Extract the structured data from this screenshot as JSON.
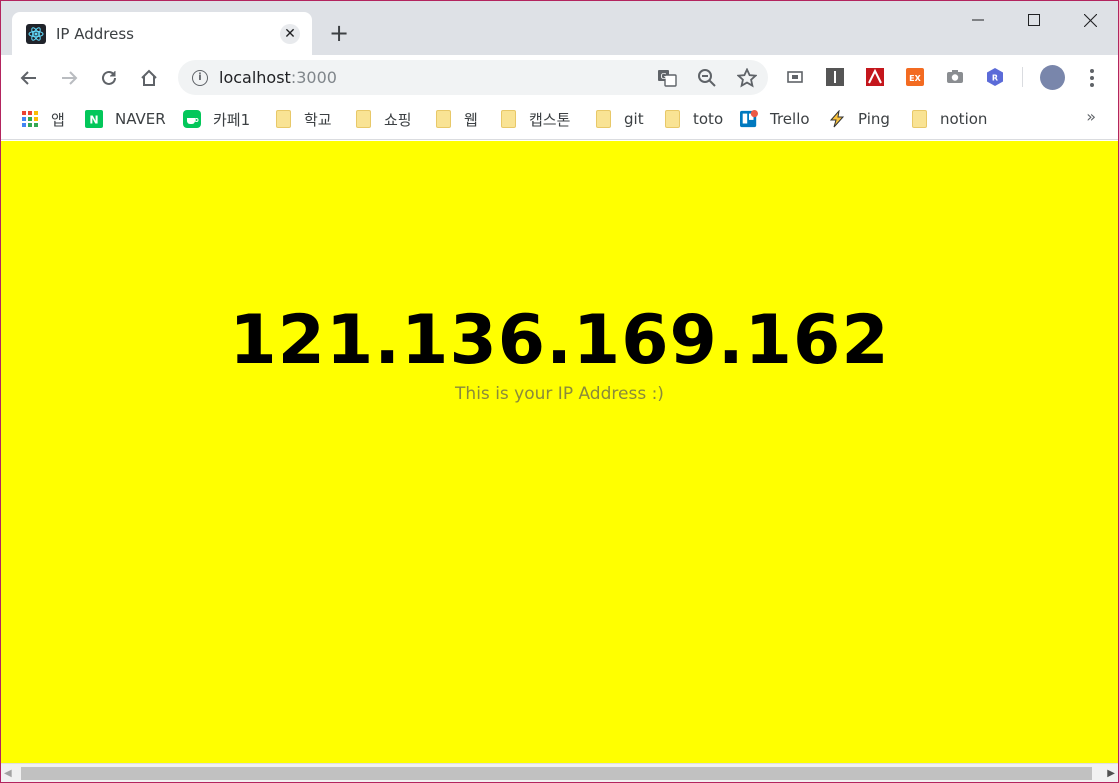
{
  "tab": {
    "title": "IP Address",
    "close_glyph": "✕",
    "new_tab_glyph": "+"
  },
  "address_bar": {
    "host": "localhost",
    "port": ":3000"
  },
  "bookmarks": [
    {
      "label": "앱",
      "icon": "apps-grid-icon"
    },
    {
      "label": "NAVER",
      "icon": "naver-icon"
    },
    {
      "label": "카페1",
      "icon": "cafe-icon"
    },
    {
      "label": "학교",
      "icon": "folder-icon"
    },
    {
      "label": "쇼핑",
      "icon": "folder-icon"
    },
    {
      "label": "웹",
      "icon": "folder-icon"
    },
    {
      "label": "캡스톤",
      "icon": "folder-icon"
    },
    {
      "label": "git",
      "icon": "folder-icon"
    },
    {
      "label": "toto",
      "icon": "folder-icon"
    },
    {
      "label": "Trello",
      "icon": "trello-icon"
    },
    {
      "label": "Ping",
      "icon": "bolt-icon"
    },
    {
      "label": "notion",
      "icon": "folder-icon"
    }
  ],
  "bookmarks_more": "»",
  "page": {
    "ip": "121.136.169.162",
    "caption": "This is your IP Address :)",
    "background": "#ffff00"
  },
  "extensions": {
    "ex_label": "EX",
    "r_label": "R"
  }
}
